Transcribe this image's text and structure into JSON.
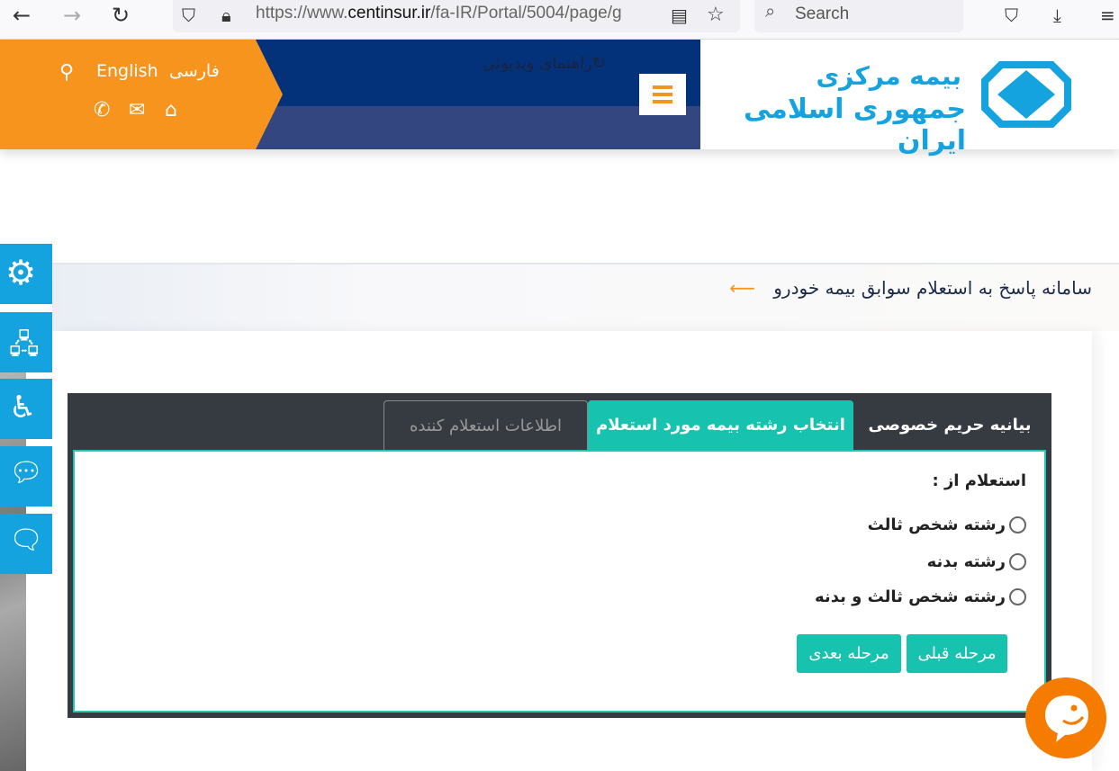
{
  "browser": {
    "url_prefix": "https://www.",
    "url_domain": "centinsur.ir",
    "url_path": "/fa-IR/Portal/5004/page/g",
    "search_placeholder": "Search"
  },
  "header": {
    "lang_fa": "فارسی",
    "lang_en": "English",
    "video_guide": "راهنمای ویدیوئی",
    "logo_text_1": "بیمه مرکزی",
    "logo_text_2": "جمهوری اسلامی ایران"
  },
  "page": {
    "title": "سامانه پاسخ به استعلام سوابق بیمه خودرو"
  },
  "tabs": [
    {
      "label": "بیانیه حریم خصوصی"
    },
    {
      "label": "انتخاب رشته بیمه مورد استعلام",
      "active": true
    },
    {
      "label": "اطلاعات استعلام کننده"
    }
  ],
  "form": {
    "label": "استعلام از :",
    "options": [
      "رشته شخص ثالث",
      "رشته بدنه",
      "رشته شخص ثالث و بدنه"
    ],
    "prev": "مرحله قبلی",
    "next": "مرحله بعدی"
  },
  "colors": {
    "orange": "#f7941d",
    "navy": "#04327a",
    "teal": "#17c3ae",
    "sidebar": "#14a3df",
    "dark": "#363a41"
  }
}
